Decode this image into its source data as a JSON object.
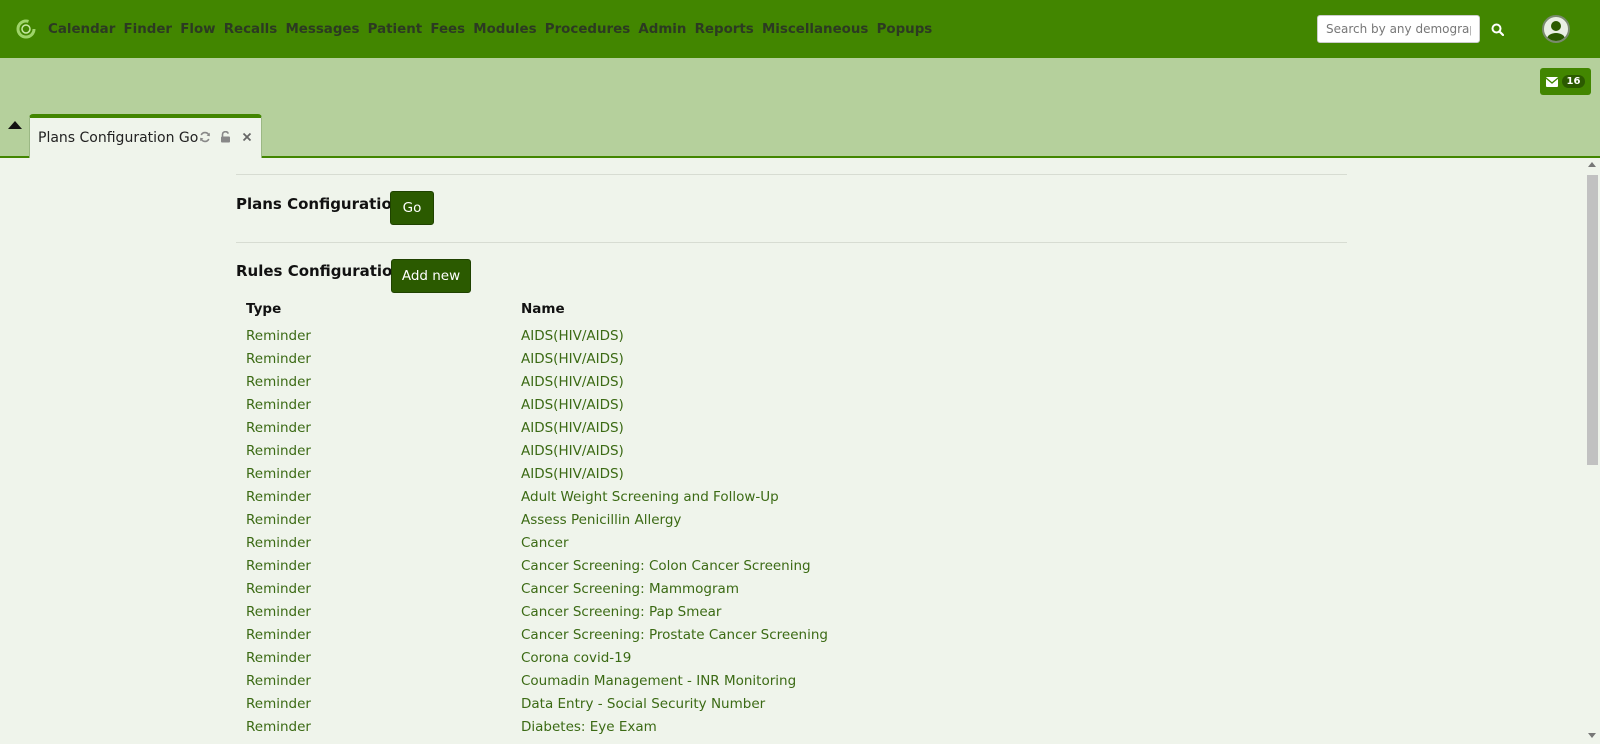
{
  "navbar": {
    "menu": [
      "Calendar",
      "Finder",
      "Flow",
      "Recalls",
      "Messages",
      "Patient",
      "Fees",
      "Modules",
      "Procedures",
      "Admin",
      "Reports",
      "Miscellaneous",
      "Popups"
    ],
    "search_placeholder": "Search by any demographics",
    "search_icon": "search-icon",
    "avatar_icon": "user-avatar-icon"
  },
  "tabbar": {
    "messages_count": "16",
    "tab_title": "Plans Configuration Go"
  },
  "plans_section": {
    "title": "Plans Configuration",
    "button": "Go"
  },
  "rules_section": {
    "title": "Rules Configuration",
    "button": "Add new",
    "columns": [
      "Type",
      "Name"
    ],
    "rows": [
      {
        "type": "Reminder",
        "name": "AIDS(HIV/AIDS)"
      },
      {
        "type": "Reminder",
        "name": "AIDS(HIV/AIDS)"
      },
      {
        "type": "Reminder",
        "name": "AIDS(HIV/AIDS)"
      },
      {
        "type": "Reminder",
        "name": "AIDS(HIV/AIDS)"
      },
      {
        "type": "Reminder",
        "name": "AIDS(HIV/AIDS)"
      },
      {
        "type": "Reminder",
        "name": "AIDS(HIV/AIDS)"
      },
      {
        "type": "Reminder",
        "name": "AIDS(HIV/AIDS)"
      },
      {
        "type": "Reminder",
        "name": "Adult Weight Screening and Follow-Up"
      },
      {
        "type": "Reminder",
        "name": "Assess Penicillin Allergy"
      },
      {
        "type": "Reminder",
        "name": "Cancer"
      },
      {
        "type": "Reminder",
        "name": "Cancer Screening: Colon Cancer Screening"
      },
      {
        "type": "Reminder",
        "name": "Cancer Screening: Mammogram"
      },
      {
        "type": "Reminder",
        "name": "Cancer Screening: Pap Smear"
      },
      {
        "type": "Reminder",
        "name": "Cancer Screening: Prostate Cancer Screening"
      },
      {
        "type": "Reminder",
        "name": "Corona covid-19"
      },
      {
        "type": "Reminder",
        "name": "Coumadin Management - INR Monitoring"
      },
      {
        "type": "Reminder",
        "name": "Data Entry - Social Security Number"
      },
      {
        "type": "Reminder",
        "name": "Diabetes: Eye Exam"
      }
    ]
  },
  "colors": {
    "navbar": "#428600",
    "tabbar": "#b5d09c",
    "content_bg": "#eff4eb",
    "button": "#2b5a00",
    "link": "#3b6a14"
  }
}
